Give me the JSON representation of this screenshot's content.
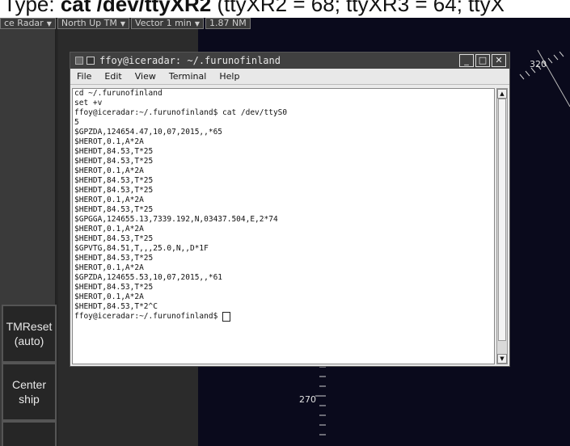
{
  "caption": {
    "prefix": "Type: ",
    "command": "cat /dev/ttyXR2",
    "suffix": " (ttyXR2 = 68; ttyXR3 = 64; ttyX"
  },
  "radar_toolbar": {
    "items": [
      {
        "label": "ce Radar"
      },
      {
        "label": "North Up TM"
      },
      {
        "label": "Vector 1 min"
      },
      {
        "label": "1.87 NM"
      }
    ]
  },
  "left_panel": {
    "buttons": [
      {
        "label": "TMReset (auto)"
      },
      {
        "label": "Center ship"
      }
    ]
  },
  "radar": {
    "bearing_320": "320",
    "bearing_270": "270"
  },
  "terminal": {
    "title": "ffoy@iceradar: ~/.furunofinland",
    "menu": [
      "File",
      "Edit",
      "View",
      "Terminal",
      "Help"
    ],
    "lines": [
      "cd ~/.furunofinland",
      "set +v",
      "ffoy@iceradar:~/.furunofinland$ cat /dev/ttyS0",
      "5",
      "$GPZDA,124654.47,10,07,2015,,*65",
      "$HEROT,0.1,A*2A",
      "$HEHDT,84.53,T*25",
      "$HEHDT,84.53,T*25",
      "$HEROT,0.1,A*2A",
      "$HEHDT,84.53,T*25",
      "$HEHDT,84.53,T*25",
      "$HEROT,0.1,A*2A",
      "$HEHDT,84.53,T*25",
      "$GPGGA,124655.13,7339.192,N,03437.504,E,2*74",
      "$HEROT,0.1,A*2A",
      "$HEHDT,84.53,T*25",
      "$GPVTG,84.51,T,,,25.0,N,,D*1F",
      "$HEHDT,84.53,T*25",
      "$HEROT,0.1,A*2A",
      "$GPZDA,124655.53,10,07,2015,,*61",
      "$HEHDT,84.53,T*25",
      "$HEROT,0.1,A*2A",
      "$HEHDT,84.53,T*2^C"
    ],
    "prompt": "ffoy@iceradar:~/.furunofinland$ "
  }
}
